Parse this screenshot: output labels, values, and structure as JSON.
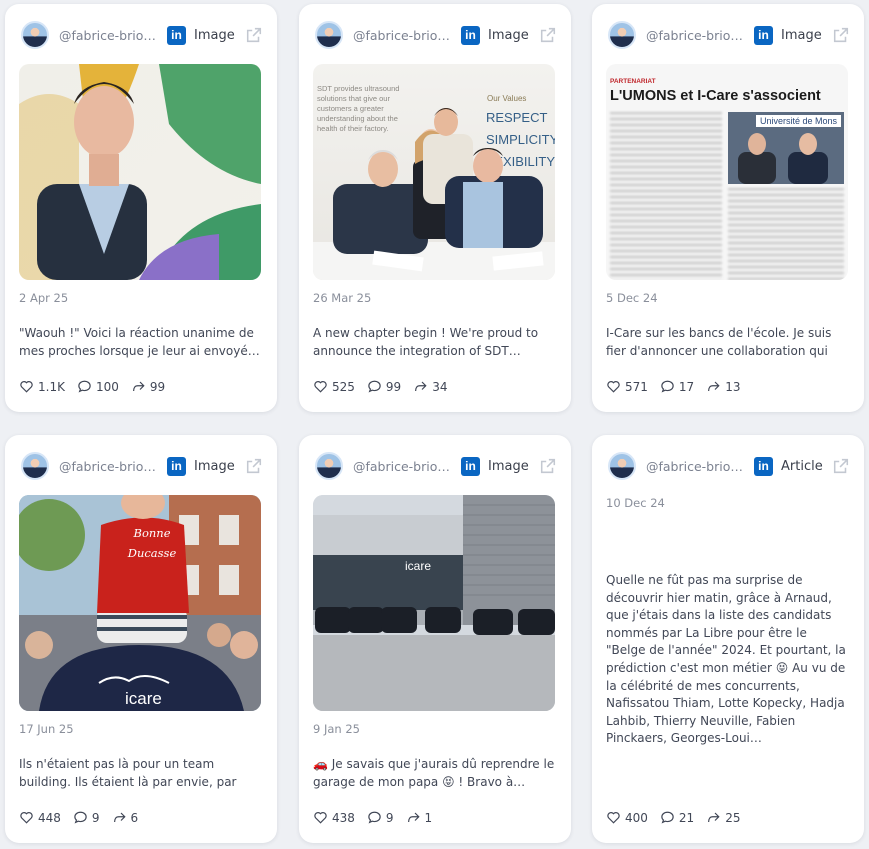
{
  "posts": [
    {
      "handle": "@fabrice-brio…",
      "network": "in",
      "type": "Image",
      "date": "2 Apr 25",
      "text": "\"Waouh !\" Voici la réaction unanime de mes proches lorsque je leur ai envoyé…",
      "likes": "1.1K",
      "comments": "100",
      "shares": "99"
    },
    {
      "handle": "@fabrice-brio…",
      "network": "in",
      "type": "Image",
      "date": "26 Mar 25",
      "text": "A new chapter begin ! We're proud to announce the integration of SDT…",
      "likes": "525",
      "comments": "99",
      "shares": "34",
      "image_text": {
        "values_title": "Our Values",
        "values": [
          "RESPECT",
          "SIMPLICITY",
          "FLEXIBILITY"
        ],
        "wall_text": "SDT provides ultrasound solutions that give our customers a greater understanding about the health of their factory."
      }
    },
    {
      "handle": "@fabrice-brio…",
      "network": "in",
      "type": "Image",
      "date": "5 Dec 24",
      "text": "I-Care sur les bancs de l'école. Je suis fier d'annoncer une collaboration qui m…",
      "likes": "571",
      "comments": "17",
      "shares": "13",
      "image_text": {
        "kicker": "PARTENARIAT",
        "headline": "L'UMONS et I-Care s'associent",
        "banner": "Université de Mons"
      }
    },
    {
      "handle": "@fabrice-brio…",
      "network": "in",
      "type": "Image",
      "date": "17 Jun 25",
      "text": "Ils n'étaient pas là pour un team building. Ils étaient là par envie, par fierté, par…",
      "likes": "448",
      "comments": "9",
      "shares": "6",
      "image_text": {
        "shirt": "Bonne Ducasse",
        "back": "icare"
      }
    },
    {
      "handle": "@fabrice-brio…",
      "network": "in",
      "type": "Image",
      "date": "9 Jan 25",
      "text": "🚗 Je savais que j'aurais dû reprendre le garage de mon papa 😝 ! Bravo à…",
      "likes": "438",
      "comments": "9",
      "shares": "1",
      "image_text": {
        "sign": "icare"
      }
    },
    {
      "handle": "@fabrice-brio…",
      "network": "in",
      "type": "Article",
      "date": "10 Dec 24",
      "text": "Quelle ne fût pas ma surprise de découvrir hier matin, grâce à Arnaud, que j'étais dans la liste des candidats nommés par La Libre pour être le \"Belge de l'année\" 2024. Et pourtant, la prédiction c'est mon métier 😝 Au vu de la célébrité de mes concurrents, Nafissatou Thiam, Lotte Kopecky, Hadja Lahbib, Thierry Neuville, Fabien Pinckaers, Georges-Loui…",
      "likes": "400",
      "comments": "21",
      "shares": "25"
    }
  ],
  "colors": {
    "linkedin": "#0a66c2",
    "background": "#eef0f4",
    "card": "#ffffff"
  },
  "icons": [
    "avatar",
    "linkedin-icon",
    "external-link-icon",
    "heart-icon",
    "comment-icon",
    "share-icon"
  ]
}
